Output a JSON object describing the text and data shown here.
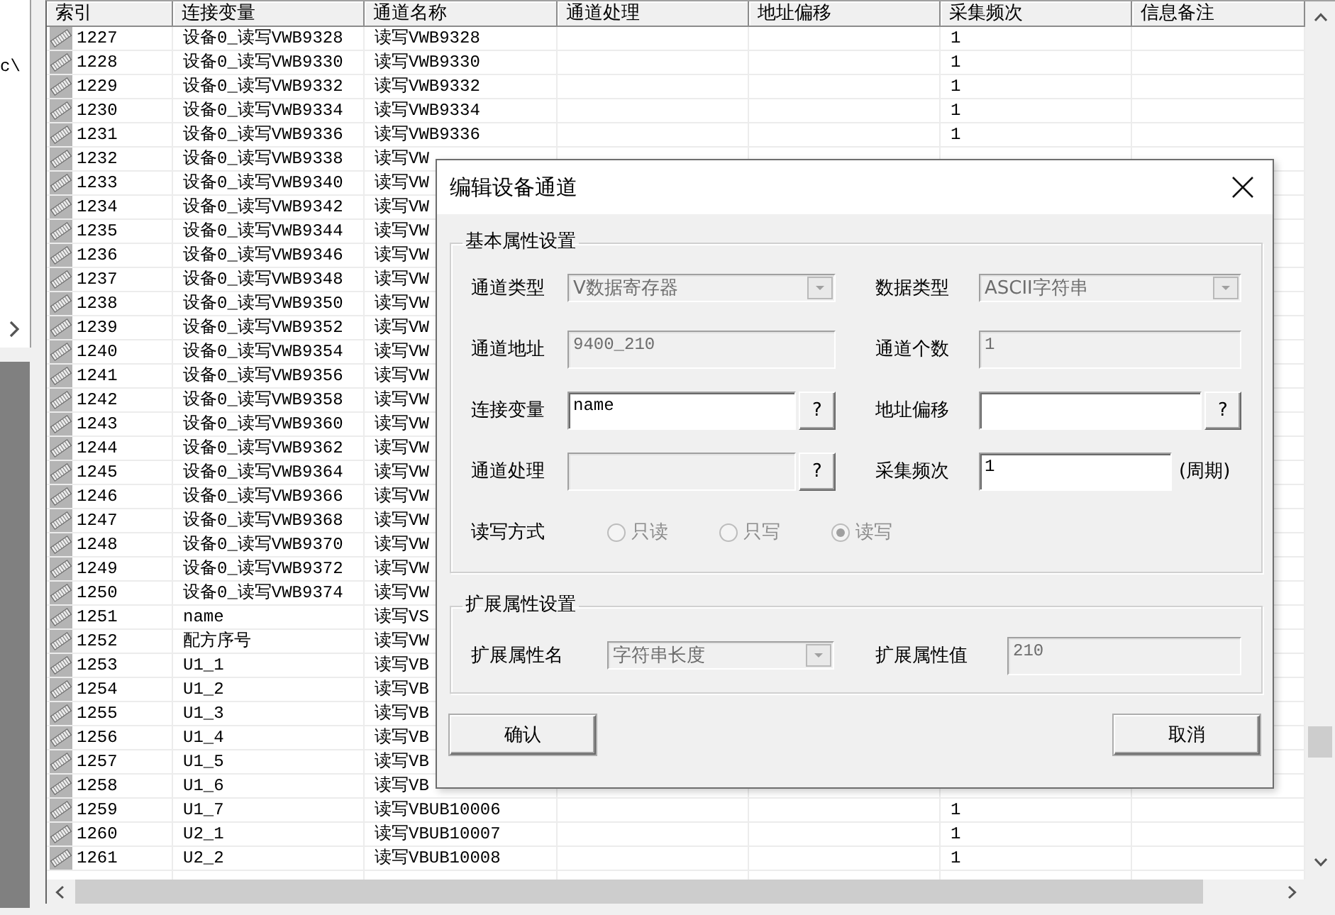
{
  "side_panel": {
    "path_fragment": "c\\"
  },
  "table": {
    "columns": [
      "索引",
      "连接变量",
      "通道名称",
      "通道处理",
      "地址偏移",
      "采集频次",
      "信息备注"
    ],
    "rows": [
      {
        "index": "1227",
        "linked_variable": "设备0_读写VWB9328",
        "channel_name": "读写VWB9328",
        "frequency": "1"
      },
      {
        "index": "1228",
        "linked_variable": "设备0_读写VWB9330",
        "channel_name": "读写VWB9330",
        "frequency": "1"
      },
      {
        "index": "1229",
        "linked_variable": "设备0_读写VWB9332",
        "channel_name": "读写VWB9332",
        "frequency": "1"
      },
      {
        "index": "1230",
        "linked_variable": "设备0_读写VWB9334",
        "channel_name": "读写VWB9334",
        "frequency": "1"
      },
      {
        "index": "1231",
        "linked_variable": "设备0_读写VWB9336",
        "channel_name": "读写VWB9336",
        "frequency": "1"
      },
      {
        "index": "1232",
        "linked_variable": "设备0_读写VWB9338",
        "channel_name": "读写VW"
      },
      {
        "index": "1233",
        "linked_variable": "设备0_读写VWB9340",
        "channel_name": "读写VW"
      },
      {
        "index": "1234",
        "linked_variable": "设备0_读写VWB9342",
        "channel_name": "读写VW"
      },
      {
        "index": "1235",
        "linked_variable": "设备0_读写VWB9344",
        "channel_name": "读写VW"
      },
      {
        "index": "1236",
        "linked_variable": "设备0_读写VWB9346",
        "channel_name": "读写VW"
      },
      {
        "index": "1237",
        "linked_variable": "设备0_读写VWB9348",
        "channel_name": "读写VW"
      },
      {
        "index": "1238",
        "linked_variable": "设备0_读写VWB9350",
        "channel_name": "读写VW"
      },
      {
        "index": "1239",
        "linked_variable": "设备0_读写VWB9352",
        "channel_name": "读写VW"
      },
      {
        "index": "1240",
        "linked_variable": "设备0_读写VWB9354",
        "channel_name": "读写VW"
      },
      {
        "index": "1241",
        "linked_variable": "设备0_读写VWB9356",
        "channel_name": "读写VW"
      },
      {
        "index": "1242",
        "linked_variable": "设备0_读写VWB9358",
        "channel_name": "读写VW"
      },
      {
        "index": "1243",
        "linked_variable": "设备0_读写VWB9360",
        "channel_name": "读写VW"
      },
      {
        "index": "1244",
        "linked_variable": "设备0_读写VWB9362",
        "channel_name": "读写VW"
      },
      {
        "index": "1245",
        "linked_variable": "设备0_读写VWB9364",
        "channel_name": "读写VW"
      },
      {
        "index": "1246",
        "linked_variable": "设备0_读写VWB9366",
        "channel_name": "读写VW"
      },
      {
        "index": "1247",
        "linked_variable": "设备0_读写VWB9368",
        "channel_name": "读写VW"
      },
      {
        "index": "1248",
        "linked_variable": "设备0_读写VWB9370",
        "channel_name": "读写VW"
      },
      {
        "index": "1249",
        "linked_variable": "设备0_读写VWB9372",
        "channel_name": "读写VW"
      },
      {
        "index": "1250",
        "linked_variable": "设备0_读写VWB9374",
        "channel_name": "读写VW"
      },
      {
        "index": "1251",
        "linked_variable": "name",
        "channel_name": "读写VS"
      },
      {
        "index": "1252",
        "linked_variable": "配方序号",
        "channel_name": "读写VW"
      },
      {
        "index": "1253",
        "linked_variable": "U1_1",
        "channel_name": "读写VB"
      },
      {
        "index": "1254",
        "linked_variable": "U1_2",
        "channel_name": "读写VB"
      },
      {
        "index": "1255",
        "linked_variable": "U1_3",
        "channel_name": "读写VB"
      },
      {
        "index": "1256",
        "linked_variable": "U1_4",
        "channel_name": "读写VB"
      },
      {
        "index": "1257",
        "linked_variable": "U1_5",
        "channel_name": "读写VB"
      },
      {
        "index": "1258",
        "linked_variable": "U1_6",
        "channel_name": "读写VB"
      },
      {
        "index": "1259",
        "linked_variable": "U1_7",
        "channel_name": "读写VBUB10006",
        "frequency": "1"
      },
      {
        "index": "1260",
        "linked_variable": "U2_1",
        "channel_name": "读写VBUB10007",
        "frequency": "1"
      },
      {
        "index": "1261",
        "linked_variable": "U2_2",
        "channel_name": "读写VBUB10008",
        "frequency": "1"
      }
    ]
  },
  "dialog": {
    "title": "编辑设备通道",
    "groups": [
      {
        "title": "基本属性设置",
        "fields": [
          {
            "kind": "combo",
            "label": "通道类型",
            "value": "V数据寄存器",
            "disabled": true
          },
          {
            "kind": "combo",
            "label": "数据类型",
            "value": "ASCII字符串",
            "disabled": true
          },
          {
            "kind": "text",
            "label": "通道地址",
            "value": "9400_210",
            "disabled": true
          },
          {
            "kind": "text",
            "label": "通道个数",
            "value": "1",
            "disabled": true
          },
          {
            "kind": "text",
            "label": "连接变量",
            "value": "name",
            "disabled": false,
            "help_button": "?"
          },
          {
            "kind": "text",
            "label": "地址偏移",
            "disabled": false,
            "help_button": "?"
          },
          {
            "kind": "text",
            "label": "通道处理",
            "disabled": true,
            "help_button": "?"
          },
          {
            "kind": "text",
            "label": "采集频次",
            "value": "1",
            "disabled": false,
            "suffix": "(周期)"
          },
          {
            "kind": "radio",
            "label": "读写方式",
            "disabled": true,
            "options": [
              {
                "label": "只读",
                "selected": false
              },
              {
                "label": "只写",
                "selected": false
              },
              {
                "label": "读写",
                "selected": true
              }
            ]
          }
        ]
      },
      {
        "title": "扩展属性设置",
        "fields": [
          {
            "kind": "combo",
            "label": "扩展属性名",
            "value": "字符串长度",
            "disabled": true
          },
          {
            "kind": "text",
            "label": "扩展属性值",
            "value": "210",
            "disabled": true
          }
        ]
      }
    ],
    "buttons": [
      "确认",
      "取消"
    ]
  }
}
